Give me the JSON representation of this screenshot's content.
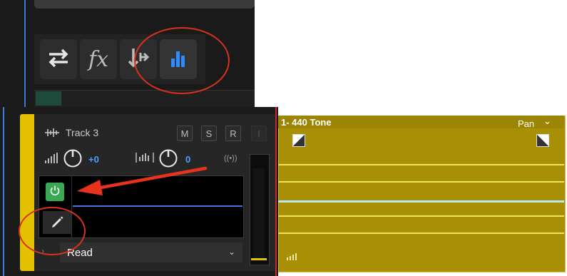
{
  "toolbar": {
    "buttons": [
      {
        "name": "routing",
        "icon": "swap-arrows-icon"
      },
      {
        "name": "effects",
        "icon": "fx-icon",
        "label": "fx"
      },
      {
        "name": "sends",
        "icon": "send-arrow-icon"
      },
      {
        "name": "eq",
        "icon": "eq-bars-icon",
        "highlighted": true
      }
    ]
  },
  "track": {
    "name": "Track 3",
    "buttons": {
      "mute": "M",
      "solo": "S",
      "record": "R",
      "input": "I"
    },
    "volume": "+0",
    "pan": "0",
    "automation_mode": "Read"
  },
  "clip": {
    "title": "1- 440 Tone",
    "param": "Pan"
  },
  "colors": {
    "accent_blue": "#4aa0ff",
    "track_yellow": "#e3c100",
    "clip_gold": "#a98f06",
    "annotation_red": "#d8321e",
    "power_green": "#3aa755"
  }
}
